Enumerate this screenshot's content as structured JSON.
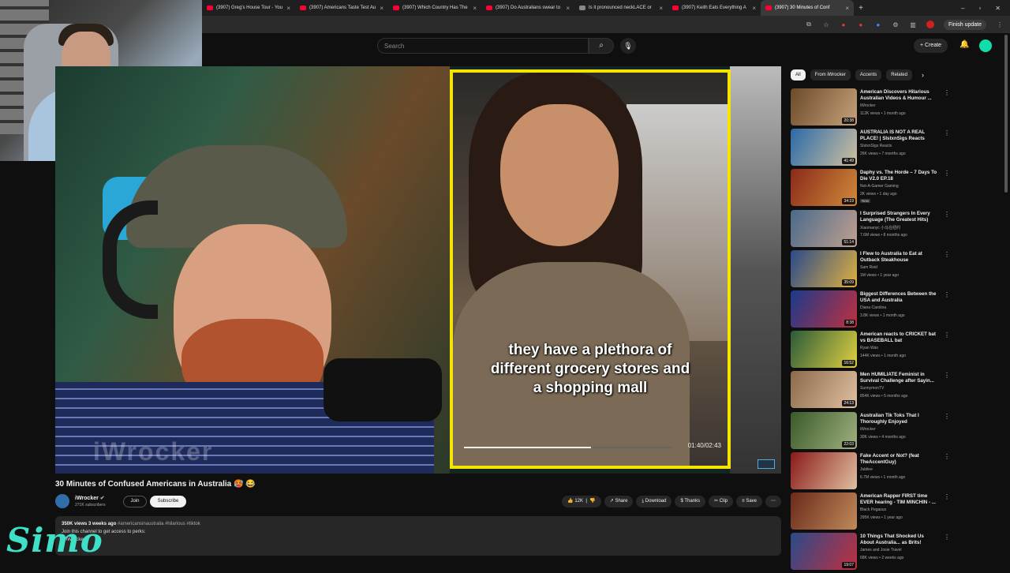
{
  "browser": {
    "tabs": [
      {
        "label": "(3907) Greg's House Tour - You"
      },
      {
        "label": "(3907) Americans Taste Test Au"
      },
      {
        "label": "(3907) Which Country Has The"
      },
      {
        "label": "(3907) Do Australians swear to"
      },
      {
        "label": "Is it pronounced neckLACE or"
      },
      {
        "label": "(3907) Keith Eats Everything A"
      },
      {
        "label": "(3907) 30 Minutes of Conf"
      }
    ],
    "finish_update": "Finish update"
  },
  "header": {
    "search_placeholder": "Search",
    "create_label": "Create"
  },
  "video": {
    "caption": "they have a plethora of different grocery stores and a shopping mall",
    "inner_time": "01:40/02:43",
    "inner_progress": 0.61,
    "watermark": "iWrocker",
    "title": "30 Minutes of Confused Americans in Australia 🥵 😂"
  },
  "channel": {
    "name": "iWrocker",
    "subs": "271K subscribers",
    "join": "Join",
    "subscribe": "Subscribe"
  },
  "actions": {
    "likes": "12K",
    "share": "Share",
    "download": "Download",
    "thanks": "Thanks",
    "clip": "Clip",
    "save": "Save"
  },
  "description": {
    "meta": "350K views  3 weeks ago",
    "tags": "#americansinaustralia #hilarious #tiktok",
    "line1": "Join this channel to get access to perks:",
    "line2": "@iWrocker"
  },
  "overlay_logo": "Simo",
  "chips": [
    "All",
    "From iWrocker",
    "Accents",
    "Related"
  ],
  "related": [
    {
      "title": "American Discovers Hilarious Australian Videos & Humour ...",
      "channel": "iWrocker",
      "stats": "112K views • 1 month ago",
      "duration": "20:38",
      "badge": "",
      "color1": "#6b4a2a",
      "color2": "#c7a27a"
    },
    {
      "title": "AUSTRALIA IS NOT A REAL PLACE! | SlstxnSigs Reacts",
      "channel": "SlstxnSigs Reacts",
      "stats": "26K views • 7 months ago",
      "duration": "41:49",
      "badge": "",
      "color1": "#2a6aa8",
      "color2": "#d0c0a0"
    },
    {
      "title": "Daphy vs. The Horde – 7 Days To Die V2.0 EP.18",
      "channel": "Not-A-Gamer Gaming",
      "stats": "2K views • 1 day ago",
      "duration": "34:19",
      "badge": "New",
      "color1": "#8a2a1a",
      "color2": "#d08a3a"
    },
    {
      "title": "I Surprised Strangers In Every Language (The Greatest Hits)",
      "channel": "Xiaomanyc 小马在纽约",
      "stats": "7.6M views • 8 months ago",
      "duration": "51:14",
      "badge": "",
      "color1": "#4a6a8a",
      "color2": "#c0a090"
    },
    {
      "title": "I Flew to Australia to Eat at Outback Steakhouse",
      "channel": "Sam Reid",
      "stats": "1M views • 1 year ago",
      "duration": "35:09",
      "badge": "",
      "color1": "#2a4a8a",
      "color2": "#e0b040"
    },
    {
      "title": "Biggest Differences Between the USA and Australia",
      "channel": "Diana Carolina",
      "stats": "3.8K views • 1 month ago",
      "duration": "8:38",
      "badge": "",
      "color1": "#1a3a8a",
      "color2": "#c03040"
    },
    {
      "title": "American reacts to CRICKET bat vs BASEBALL bat",
      "channel": "Ryan Was",
      "stats": "144K views • 1 month ago",
      "duration": "16:52",
      "badge": "",
      "color1": "#2a5a3a",
      "color2": "#e0d040"
    },
    {
      "title": "Men HUMILIATE Feminist in Survival Challenge after Sayin...",
      "channel": "SunnymonTV",
      "stats": "854K views • 5 months ago",
      "duration": "24:13",
      "badge": "",
      "color1": "#8a6a4a",
      "color2": "#e0c0a0"
    },
    {
      "title": "Australian Tik Toks That I Thoroughly Enjoyed",
      "channel": "iWrocker",
      "stats": "30K views • 4 months ago",
      "duration": "22:03",
      "badge": "",
      "color1": "#3a5a2a",
      "color2": "#a0b080"
    },
    {
      "title": "Fake Accent or Not? (feat TheAccentGuy)",
      "channel": "Jubilee",
      "stats": "6.7M views • 1 month ago",
      "duration": "",
      "badge": "",
      "color1": "#8a1a1a",
      "color2": "#e0c0a0"
    },
    {
      "title": "American Rapper FIRST time EVER hearing - TIM MINCHIN - ...",
      "channel": "Black Pegasus",
      "stats": "295K views • 1 year ago",
      "duration": "",
      "badge": "",
      "color1": "#6a2a1a",
      "color2": "#c08a5a"
    },
    {
      "title": "10 Things That Shocked Us About Australia... as Brits!",
      "channel": "James and Josie Travel",
      "stats": "68K views • 2 weeks ago",
      "duration": "19:07",
      "badge": "",
      "color1": "#2a4a8a",
      "color2": "#c03040"
    }
  ]
}
